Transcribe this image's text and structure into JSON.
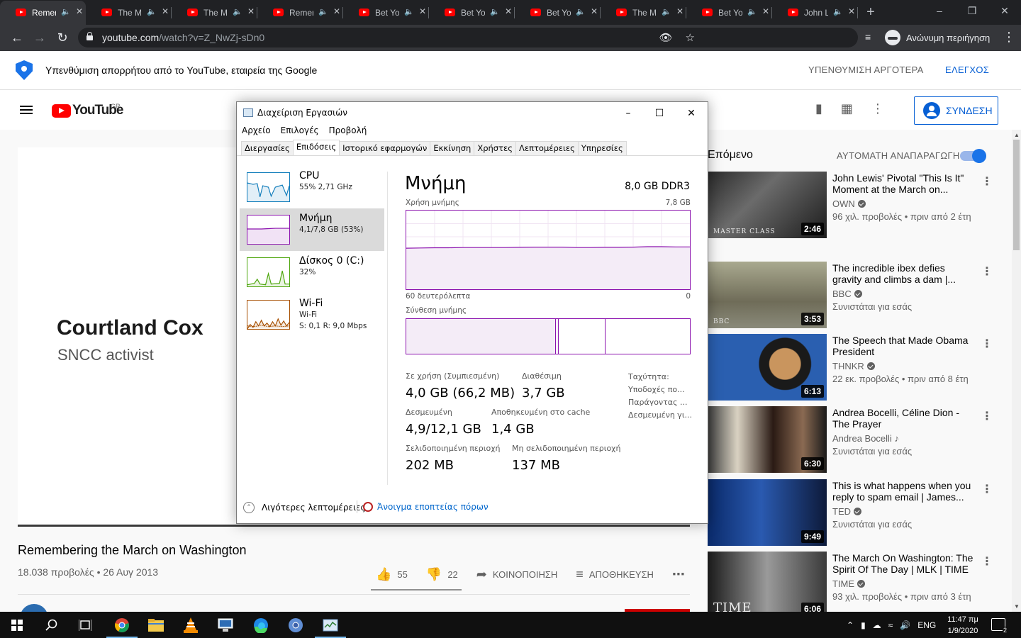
{
  "browser": {
    "tabs": [
      {
        "title": "Remembering the March on Washington"
      },
      {
        "title": "The March on Washington"
      },
      {
        "title": "The March on Washington"
      },
      {
        "title": "Remembering the March"
      },
      {
        "title": "Bet You Didn't Know"
      },
      {
        "title": "Bet You Didn't Know"
      },
      {
        "title": "Bet You Didn't Know"
      },
      {
        "title": "The March on Washington"
      },
      {
        "title": "Bet You Didn't Know"
      },
      {
        "title": "John Lewis"
      }
    ],
    "url_domain": "youtube.com",
    "url_path": "/watch?v=Z_NwZj-sDn0",
    "incognito_label": "Ανώνυμη περιήγηση"
  },
  "privacy_bar": {
    "text": "Υπενθύμιση απορρήτου από το YouTube, εταιρεία της Google",
    "remind_later": "ΥΠΕΝΘΥΜΙΣΗ ΑΡΓΟΤΕΡΑ",
    "check": "ΕΛΕΓΧΟΣ"
  },
  "youtube": {
    "logo_text": "YouTube",
    "region": "GR",
    "signin_label": "ΣΥΝΔΕΣΗ"
  },
  "video": {
    "overlay_name": "Courtland Cox",
    "overlay_role": "SNCC activist",
    "title": "Remembering the March on Washington",
    "meta": "18.038 προβολές • 26 Αυγ 2013",
    "likes": "55",
    "dislikes": "22",
    "share": "ΚΟΙΝΟΠΟΙΗΣΗ",
    "save": "ΑΠΟΘΗΚΕΥΣΗ"
  },
  "sidebar": {
    "up_next": "Επόμενο",
    "autoplay": "ΑΥΤΟΜΑΤΗ ΑΝΑΠΑΡΑΓΩΓΗ",
    "recs": [
      {
        "title": "John Lewis' Pivotal \"This Is It\" Moment at the March on...",
        "channel": "OWN",
        "verified": true,
        "meta": "96 χιλ. προβολές • πριν από 2 έτη",
        "duration": "2:46",
        "thumb_text": "MASTER CLASS"
      },
      {
        "title": "The incredible ibex defies gravity and climbs a dam |...",
        "channel": "BBC",
        "verified": true,
        "meta": "Συνιστάται για εσάς",
        "duration": "3:53",
        "thumb_text": "BBC"
      },
      {
        "title": "The Speech that Made Obama President",
        "channel": "THNKR",
        "verified": true,
        "meta": "22 εκ. προβολές • πριν από 8 έτη",
        "duration": "6:13",
        "thumb_text": ""
      },
      {
        "title": "Andrea Bocelli, Céline Dion - The Prayer",
        "channel": "Andrea Bocelli ♪",
        "verified": false,
        "meta": "Συνιστάται για εσάς",
        "duration": "6:30",
        "thumb_text": ""
      },
      {
        "title": "This is what happens when you reply to spam email | James...",
        "channel": "TED",
        "verified": true,
        "meta": "Συνιστάται για εσάς",
        "duration": "9:49",
        "thumb_text": ""
      },
      {
        "title": "The March On Washington: The Spirit Of The Day | MLK | TIME",
        "channel": "TIME",
        "verified": true,
        "meta": "93 χιλ. προβολές • πριν από 3 έτη",
        "duration": "6:06",
        "thumb_text": "TIME"
      }
    ]
  },
  "taskmgr": {
    "title": "Διαχείριση Εργασιών",
    "menu": [
      "Αρχείο",
      "Επιλογές",
      "Προβολή"
    ],
    "tabs": [
      "Διεργασίες",
      "Επιδόσεις",
      "Ιστορικό εφαρμογών",
      "Εκκίνηση",
      "Χρήστες",
      "Λεπτομέρειες",
      "Υπηρεσίες"
    ],
    "active_tab": 1,
    "side": [
      {
        "name": "CPU",
        "value": "55% 2,71 GHz",
        "value2": ""
      },
      {
        "name": "Μνήμη",
        "value": "4,1/7,8 GB (53%)",
        "value2": ""
      },
      {
        "name": "Δίσκος 0 (C:)",
        "value": "32%",
        "value2": ""
      },
      {
        "name": "Wi-Fi",
        "value": "Wi-Fi",
        "value2": "S: 0,1 R: 9,0 Mbps"
      }
    ],
    "memory": {
      "heading": "Μνήμη",
      "type": "8,0 GB DDR3",
      "usage_label": "Χρήση μνήμης",
      "usage_max": "7,8 GB",
      "time_label": "60 δευτερόλεπτα",
      "time_zero": "0",
      "composition_label": "Σύνθεση μνήμης",
      "usage_fraction": 0.53,
      "stats": [
        {
          "label": "Σε χρήση (Συμπιεσμένη)",
          "value": "4,0 GB (66,2 MB)"
        },
        {
          "label": "Διαθέσιμη",
          "value": "3,7 GB"
        },
        {
          "label": "Δεσμευμένη",
          "value": "4,9/12,1 GB"
        },
        {
          "label": "Αποθηκευμένη στο cache",
          "value": "1,4 GB"
        },
        {
          "label": "Σελιδοποιημένη περιοχή",
          "value": "202 MB"
        },
        {
          "label": "Μη σελιδοποιημένη περιοχή",
          "value": "137 MB"
        }
      ],
      "right_labels": [
        "Ταχύτητα:",
        "Υποδοχές πο...",
        "Παράγοντας ...",
        "Δεσμευμένη γι..."
      ]
    },
    "footer_less": "Λιγότερες λεπτομέρειες",
    "footer_monitor": "Άνοιγμα εποπτείας πόρων"
  },
  "taskbar": {
    "lang": "ENG",
    "time": "11:47 πμ",
    "date": "1/9/2020",
    "notifications": "2"
  },
  "colors": {
    "accent_blue": "#065fd4",
    "yt_red": "#ff0000",
    "memory_purple": "#8b12ae",
    "cpu_blue": "#117dbb",
    "disk_green": "#4da60c",
    "wifi_orange": "#a74f01"
  }
}
